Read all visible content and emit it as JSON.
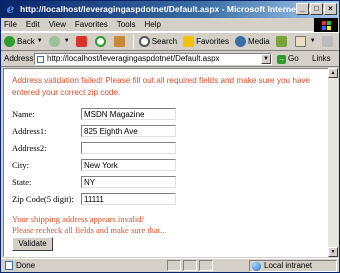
{
  "window": {
    "title": "http://localhost/leveragingaspdotnet/Default.aspx - Microsoft Internet Explorer"
  },
  "menu": [
    "File",
    "Edit",
    "View",
    "Favorites",
    "Tools",
    "Help"
  ],
  "toolbar": {
    "back": "Back",
    "search": "Search",
    "favorites": "Favorites",
    "media": "Media"
  },
  "address": {
    "label": "Address",
    "url": "http://localhost/leveragingaspdotnet/Default.aspx",
    "go": "Go",
    "links": "Links"
  },
  "page": {
    "error_message": "Address validation failed! Please fill out all required fields and make sure you have entered your correct zip code.",
    "fields": [
      {
        "label": "Name:",
        "value": ""
      },
      {
        "label": "Address1:",
        "value": ""
      },
      {
        "label": "Address2:",
        "value": ""
      },
      {
        "label": "City:",
        "value": ""
      },
      {
        "label": "State:",
        "value": ""
      },
      {
        "label": "Zip Code(5 digit):",
        "value": ""
      }
    ],
    "values": {
      "name": "MSDN Magazine",
      "address1": "825 Eighth Ave",
      "address2": "",
      "city": "New York",
      "state": "NY",
      "zip": "11111"
    },
    "validation_line1": "Your shipping address appears invalid!",
    "validation_line2": "Please recheck all fields and make sure that...",
    "validate_button": "Validate"
  },
  "status": {
    "text": "Done",
    "zone": "Local intranet"
  },
  "colors": {
    "error": "#d9502a",
    "titlebar": "#0a246a"
  }
}
